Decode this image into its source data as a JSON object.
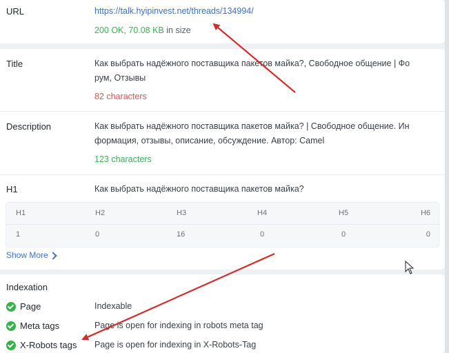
{
  "url": {
    "label": "URL",
    "link": "https://talk.hyipinvest.net/threads/134994/",
    "status": "200 OK, 70.08 KB",
    "status_suffix": " in size"
  },
  "title": {
    "label": "Title",
    "line1": "Как выбрать надёжного поставщика пакетов майка?, Свободное общение | Фо",
    "line2": "рум, Отзывы",
    "count": "82 characters"
  },
  "description": {
    "label": "Description",
    "line1": "Как выбрать надёжного поставщика пакетов майка? | Свободное общение. Ин",
    "line2": "формация, отзывы, описание, обсуждение. Автор: Camel",
    "count": "123 characters"
  },
  "h1": {
    "label": "H1",
    "value": "Как выбрать надёжного поставщика пакетов майка?"
  },
  "headings": {
    "headers": [
      "H1",
      "H2",
      "H3",
      "H4",
      "H5",
      "H6"
    ],
    "values": [
      "1",
      "0",
      "16",
      "0",
      "0",
      "0"
    ]
  },
  "show_more": "Show More",
  "indexation": {
    "title": "Indexation",
    "rows": [
      {
        "label": "Page",
        "value": "Indexable"
      },
      {
        "label": "Meta tags",
        "value": "Page is open for indexing in robots meta tag"
      },
      {
        "label": "X-Robots tags",
        "value": "Page is open for indexing in X-Robots-Tag"
      }
    ]
  },
  "colors": {
    "accent": "#3d6fcf",
    "success": "#3fae55",
    "error": "#e05252",
    "arrow": "#d42b2b"
  }
}
